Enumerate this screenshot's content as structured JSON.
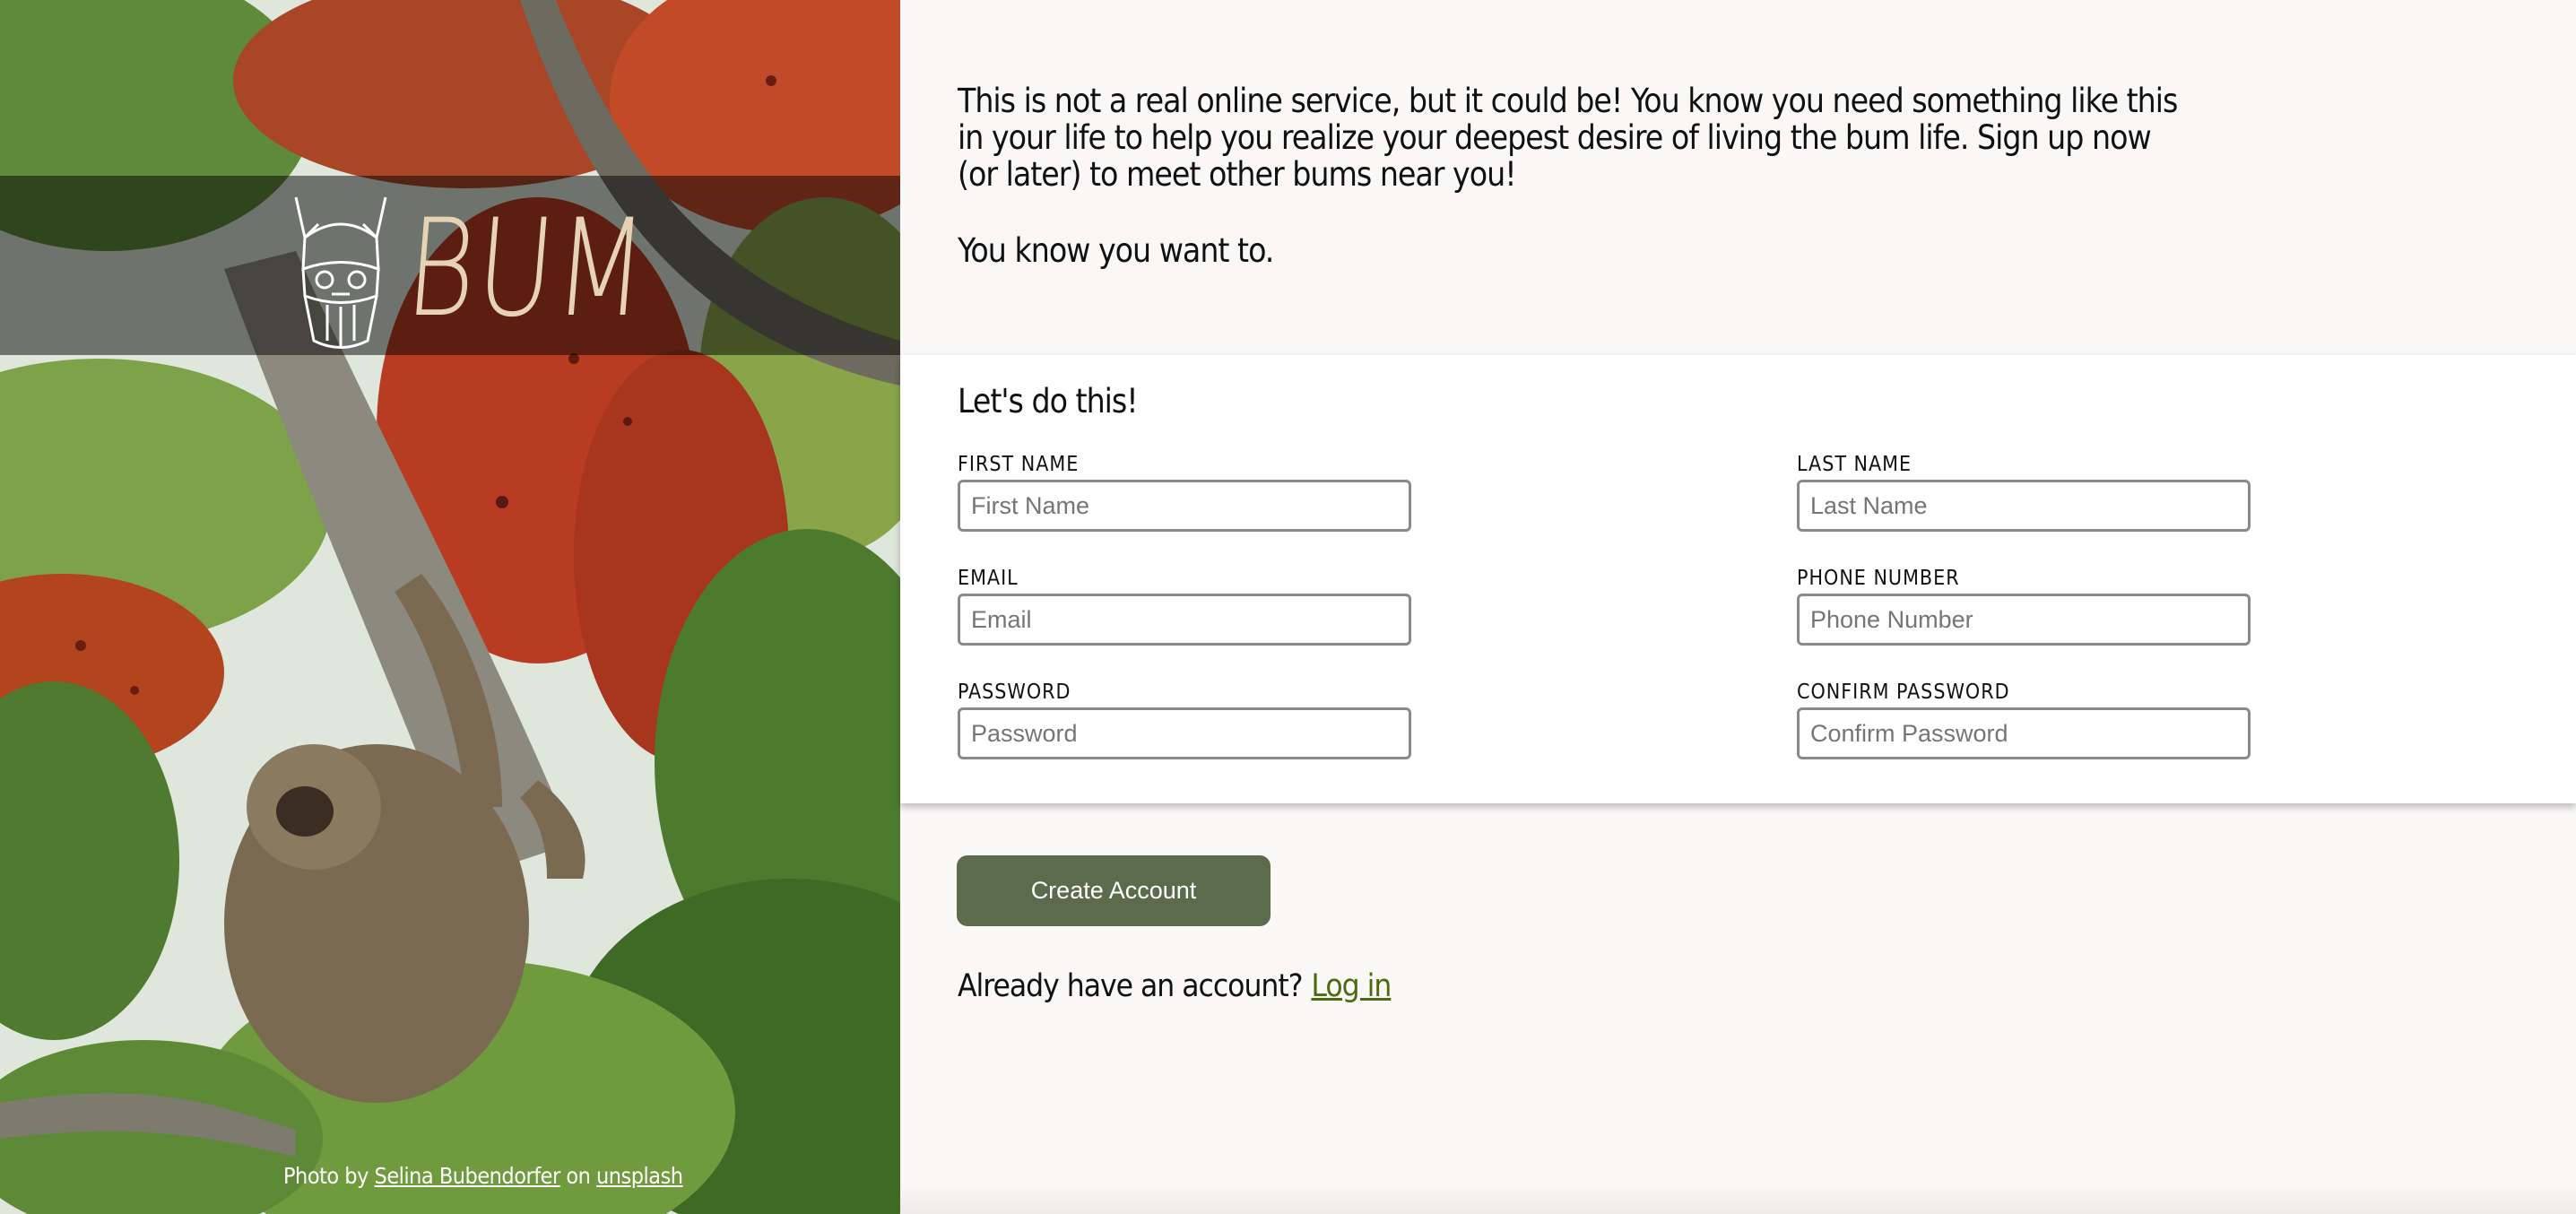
{
  "brand": {
    "logo_text": "BUM",
    "logo_icon": "viking-bum-icon"
  },
  "photo_credit": {
    "prefix": "Photo by",
    "author": "Selina Bubendorfer",
    "middle": "on",
    "site": "unsplash"
  },
  "intro": {
    "paragraph_1": "This is not a real online service, but it could be! You know you need something like this in your life to help you realize your deepest desire of living the bum life. Sign up now (or later) to meet other bums near you!",
    "paragraph_2": "You know you want to."
  },
  "form": {
    "title": "Let's do this!",
    "fields": {
      "first_name": {
        "label": "First Name",
        "placeholder": "First Name"
      },
      "last_name": {
        "label": "Last Name",
        "placeholder": "Last Name"
      },
      "email": {
        "label": "Email",
        "placeholder": "Email"
      },
      "phone": {
        "label": "Phone Number",
        "placeholder": "Phone Number"
      },
      "password": {
        "label": "Password",
        "placeholder": "Password"
      },
      "confirm_password": {
        "label": "Confirm Password",
        "placeholder": "Confirm Password"
      }
    }
  },
  "actions": {
    "create_account": "Create Account",
    "login_prompt": "Already have an account?",
    "login_link": "Log in"
  },
  "colors": {
    "button": "#5b6b4b",
    "link": "#4c6a10",
    "page_bg": "#f9f8f7",
    "logo": "#e6d2b4"
  }
}
